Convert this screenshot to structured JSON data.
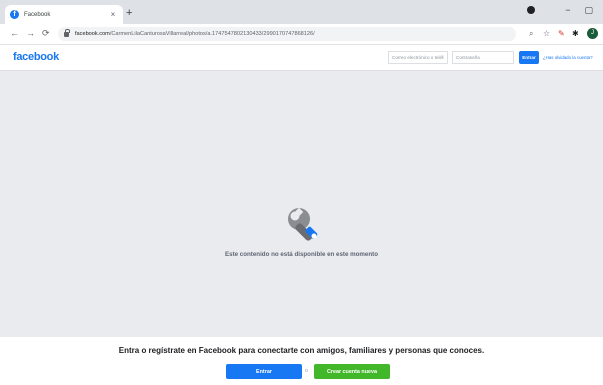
{
  "browser": {
    "tab_title": "Facebook",
    "tab_favicon_letter": "f",
    "tab_close": "×",
    "new_tab": "+",
    "url_host": "facebook.com",
    "url_path": "/CarmenLilaCanturosaVillarreal/photos/a.1747547802130433/2990170747868126/",
    "window_minimize": "−",
    "window_restore": "▢",
    "avatar_letter": "J",
    "colors": {
      "tabstrip": "#dee1e6",
      "omnibox": "#f1f3f4"
    }
  },
  "fb_header": {
    "logo": "facebook",
    "email_placeholder": "Correo electrónico o teléfono",
    "password_placeholder": "Contraseña",
    "login_label": "Entrar",
    "forgot_link": "¿Has olvidado la cuenta?"
  },
  "content": {
    "message": "Este contenido no está disponible en este momento",
    "icon": "wrench-icon"
  },
  "banner": {
    "text": "Entra o regístrate en Facebook para conectarte con amigos, familiares y personas que conoces.",
    "enter_label": "Entrar",
    "or_label": "o",
    "create_label": "Crear cuenta nueva"
  },
  "colors": {
    "brand": "#1877f2",
    "create_green": "#42b72a",
    "content_bg": "#e9ebee"
  }
}
